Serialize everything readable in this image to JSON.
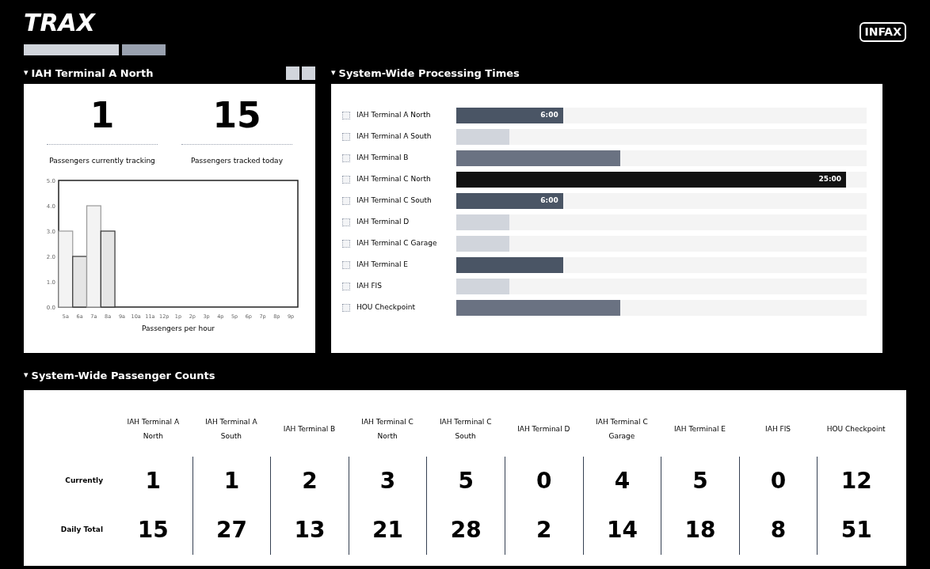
{
  "header": {
    "logo": "TRAX",
    "brand": "INFAX"
  },
  "terminal_panel": {
    "toggle": "▾",
    "title": "IAH Terminal A North",
    "stats": [
      {
        "value": "1",
        "label": "Passengers currently tracking"
      },
      {
        "value": "15",
        "label": "Passengers tracked today"
      }
    ],
    "chart_data": {
      "type": "bar",
      "xlabel": "Passengers per hour",
      "categories": [
        "5a",
        "6a",
        "7a",
        "8a",
        "9a",
        "10a",
        "11a",
        "12p",
        "1p",
        "2p",
        "3p",
        "4p",
        "5p",
        "6p",
        "7p",
        "8p",
        "9p"
      ],
      "values": [
        3,
        2,
        4,
        3,
        0,
        0,
        0,
        0,
        0,
        0,
        0,
        0,
        0,
        0,
        0,
        0,
        0
      ],
      "ylim": [
        0,
        5
      ],
      "yticks": [
        {
          "value": 0,
          "label": "0.0"
        },
        {
          "value": 1,
          "label": "1.0"
        },
        {
          "value": 2,
          "label": "2.0"
        },
        {
          "value": 3,
          "label": "3.0"
        },
        {
          "value": 4,
          "label": "4.0"
        },
        {
          "value": 5,
          "label": "5.0"
        }
      ]
    }
  },
  "processing_panel": {
    "toggle": "▾",
    "title": "System-Wide Processing Times",
    "rows": [
      {
        "name": "IAH Terminal A North",
        "level": 0.26,
        "time": "6:00"
      },
      {
        "name": "IAH Terminal A South",
        "level": 0.13
      },
      {
        "name": "IAH Terminal B",
        "level": 0.4
      },
      {
        "name": "IAH Terminal C North",
        "level": 0.95,
        "time": "25:00"
      },
      {
        "name": "IAH Terminal C South",
        "level": 0.26,
        "time": "6:00"
      },
      {
        "name": "IAH Terminal D",
        "level": 0.13
      },
      {
        "name": "IAH Terminal C Garage",
        "level": 0.13
      },
      {
        "name": "IAH Terminal E",
        "level": 0.26
      },
      {
        "name": "IAH FIS",
        "level": 0.13
      },
      {
        "name": "HOU Checkpoint",
        "level": 0.4
      }
    ]
  },
  "counts_panel": {
    "toggle": "▾",
    "title": "System-Wide Passenger Counts",
    "row_labels": [
      "Currently",
      "Daily Total"
    ],
    "columns": [
      {
        "name": "IAH Terminal A North",
        "currently": "1",
        "daily_total": "15"
      },
      {
        "name": "IAH Terminal A South",
        "currently": "1",
        "daily_total": "27"
      },
      {
        "name": "IAH Terminal B",
        "currently": "2",
        "daily_total": "13"
      },
      {
        "name": "IAH Terminal C North",
        "currently": "3",
        "daily_total": "21"
      },
      {
        "name": "IAH Terminal C South",
        "currently": "5",
        "daily_total": "28"
      },
      {
        "name": "IAH Terminal D",
        "currently": "0",
        "daily_total": "2"
      },
      {
        "name": "IAH Terminal C Garage",
        "currently": "4",
        "daily_total": "14"
      },
      {
        "name": "IAH Terminal E",
        "currently": "5",
        "daily_total": "18"
      },
      {
        "name": "IAH FIS",
        "currently": "0",
        "daily_total": "8"
      },
      {
        "name": "HOU Checkpoint",
        "currently": "12",
        "daily_total": "51"
      }
    ]
  }
}
